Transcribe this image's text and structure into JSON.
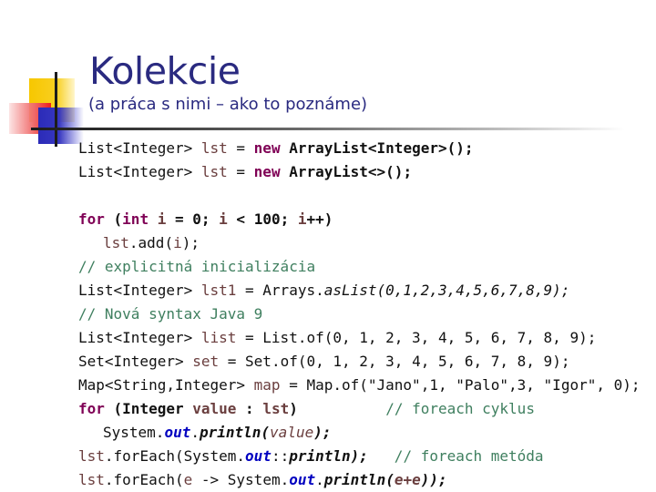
{
  "slide": {
    "title": "Kolekcie",
    "subtitle": "(a práca s nimi – ako to poznáme)",
    "colors": {
      "title": "#2a2a80",
      "keyword": "#7f0055",
      "variable": "#6a3e3e",
      "comment": "#3f7f5f",
      "static_field": "#0000c0"
    }
  },
  "code": {
    "l1": {
      "a": "List<Integer> ",
      "b": "lst",
      "c": " = ",
      "d": "new",
      "e": " ArrayList<Integer>();"
    },
    "l2": {
      "a": "List<Integer> ",
      "b": "lst",
      "c": " = ",
      "d": "new",
      "e": " ArrayList<>();"
    },
    "l3": {
      "a": "for",
      "b": " (",
      "c": "int",
      "d": " ",
      "e": "i",
      "f": " = 0; ",
      "g": "i",
      "h": " < 100; ",
      "i": "i",
      "j": "++)"
    },
    "l4": {
      "a": "lst",
      "b": ".add(",
      "c": "i",
      "d": ");"
    },
    "l5": {
      "a": "// explicitná inicializácia"
    },
    "l6": {
      "a": "List<Integer> ",
      "b": "lst1",
      "c": " = Arrays.",
      "d": "asList(0,1,2,3,4,5,6,7,8,9);"
    },
    "l7": {
      "a": "// Nová syntax Java 9"
    },
    "l8": {
      "a": "List<Integer> ",
      "b": "list",
      "c": " = List.of(0, 1, 2, 3, 4, 5, 6, 7, 8, 9);"
    },
    "l9": {
      "a": "Set<Integer> ",
      "b": "set",
      "c": " = Set.of(0, 1, 2, 3, 4, 5, 6, 7, 8, 9);"
    },
    "l10": {
      "a": "Map<String,Integer> ",
      "b": "map",
      "c": " = Map.of(\"Jano\",1, \"Palo\",3, \"Igor\", 0);"
    },
    "l11": {
      "a": "for",
      "b": " (Integer ",
      "c": "value",
      "d": " : ",
      "e": "lst",
      "f": ")",
      "g": "          // foreach cyklus"
    },
    "l12": {
      "a": "System.",
      "b": "out",
      "c": ".",
      "d": "println(",
      "e": "value",
      "f": ");"
    },
    "l13": {
      "a": "lst",
      "b": ".forEach(System.",
      "c": "out",
      "d": "::",
      "e": "println);",
      "f": "   // foreach metóda"
    },
    "l14": {
      "a": "lst",
      "b": ".forEach(",
      "c": "e",
      "d": " -> System.",
      "e": "out",
      "f": ".",
      "g": "println(",
      "h": "e+e",
      "i": "));"
    }
  }
}
